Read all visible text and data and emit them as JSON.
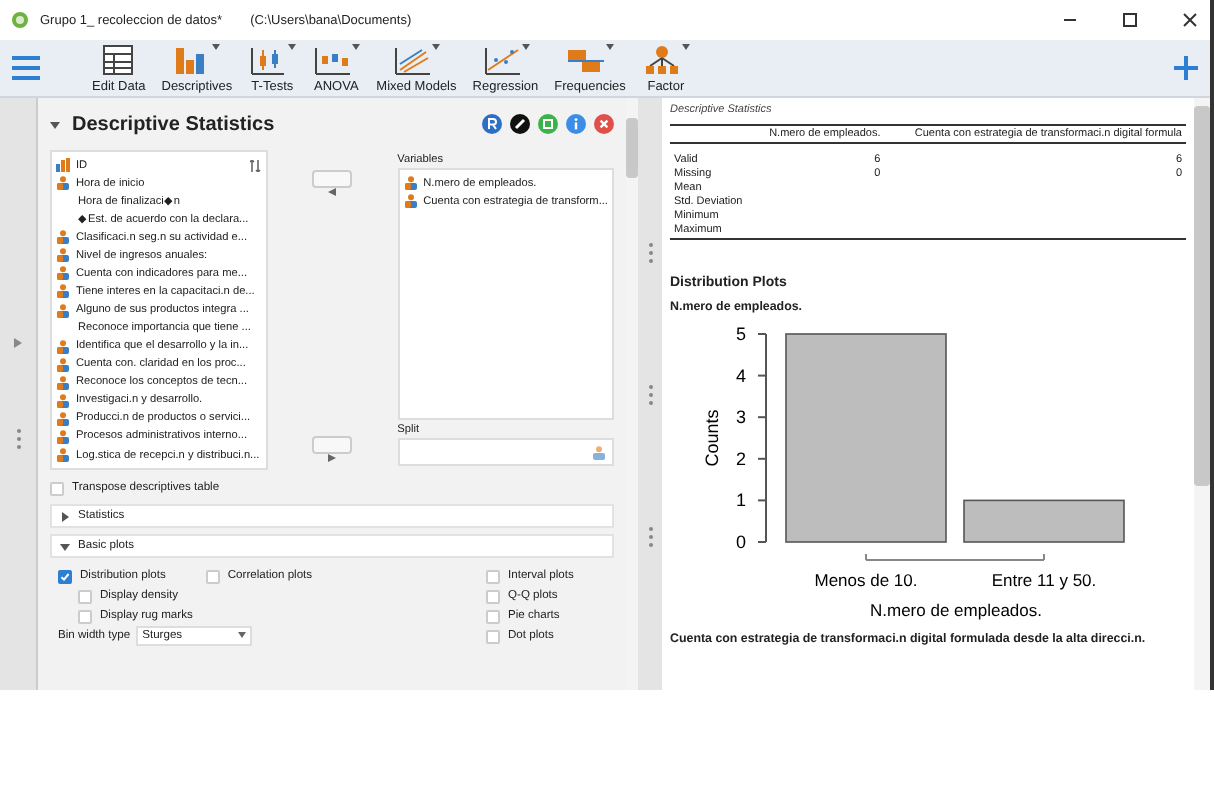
{
  "window": {
    "title": "Grupo 1_ recoleccion de datos*",
    "path": "(C:\\Users\\bana\\Documents)"
  },
  "toolbar": [
    {
      "label": "Edit Data",
      "kind": "table",
      "menu": false
    },
    {
      "label": "Descriptives",
      "kind": "bars",
      "menu": true
    },
    {
      "label": "T-Tests",
      "kind": "ttest",
      "menu": true
    },
    {
      "label": "ANOVA",
      "kind": "anova",
      "menu": true
    },
    {
      "label": "Mixed Models",
      "kind": "mixed",
      "menu": true
    },
    {
      "label": "Regression",
      "kind": "regression",
      "menu": true
    },
    {
      "label": "Frequencies",
      "kind": "frequencies",
      "menu": true
    },
    {
      "label": "Factor",
      "kind": "factor",
      "menu": true
    }
  ],
  "analysis": {
    "title": "Descriptive Statistics",
    "expanded": true,
    "variables_list": [
      {
        "name": "ID",
        "kind": "scale"
      },
      {
        "name": "Hora de inicio",
        "kind": "nominal"
      },
      {
        "name": "Hora de finalizaci◆n",
        "kind": "none"
      },
      {
        "name": "◆Est. de acuerdo con la declara...",
        "kind": "none"
      },
      {
        "name": "Clasificaci.n seg.n su actividad e...",
        "kind": "nominal"
      },
      {
        "name": "Nivel de ingresos anuales:",
        "kind": "nominal"
      },
      {
        "name": "Cuenta con indicadores para me...",
        "kind": "nominal"
      },
      {
        "name": "Tiene interes en la capacitaci.n de...",
        "kind": "nominal"
      },
      {
        "name": "Alguno de sus productos integra ...",
        "kind": "nominal"
      },
      {
        "name": "Reconoce importancia que tiene ...",
        "kind": "none"
      },
      {
        "name": "Identifica que el desarrollo y la in...",
        "kind": "nominal"
      },
      {
        "name": "Cuenta con. claridad en los proc...",
        "kind": "nominal"
      },
      {
        "name": "Reconoce los conceptos de tecn...",
        "kind": "nominal"
      },
      {
        "name": "Investigaci.n y desarrollo.",
        "kind": "nominal"
      },
      {
        "name": "Producci.n de productos o servici...",
        "kind": "nominal"
      },
      {
        "name": "Procesos administrativos interno...",
        "kind": "nominal"
      },
      {
        "name": "Log.stica de recepci.n y distribuci.n...",
        "kind": "nominal"
      }
    ],
    "variables_label": "Variables",
    "assigned": [
      {
        "name": "N.mero de empleados.",
        "kind": "nominal"
      },
      {
        "name": "Cuenta con estrategia de transform...",
        "kind": "nominal"
      }
    ],
    "split_label": "Split",
    "transpose": {
      "label": "Transpose descriptives table",
      "checked": false
    },
    "sections": [
      {
        "title": "Statistics",
        "expanded": false
      },
      {
        "title": "Basic plots",
        "expanded": true
      }
    ],
    "left_options": [
      {
        "label": "Distribution plots",
        "checked": true,
        "children": [
          {
            "label": "Display density",
            "checked": false
          },
          {
            "label": "Display rug marks",
            "checked": false
          }
        ]
      },
      {
        "label": "Correlation plots",
        "checked": false
      }
    ],
    "bin_width": {
      "label": "Bin width type",
      "value": "Sturges"
    },
    "right_options": [
      {
        "label": "Interval plots",
        "checked": false
      },
      {
        "label": "Q-Q plots",
        "checked": false
      },
      {
        "label": "Pie charts",
        "checked": false
      },
      {
        "label": "Dot plots",
        "checked": false
      }
    ]
  },
  "results": {
    "table": {
      "caption": "Descriptive Statistics",
      "columns": [
        "N.mero de empleados.",
        "Cuenta con estrategia de transformaci.n digital formula"
      ],
      "rows": [
        {
          "label": "Valid",
          "values": [
            "6",
            "6"
          ]
        },
        {
          "label": "Missing",
          "values": [
            "0",
            "0"
          ]
        },
        {
          "label": "Mean"
        },
        {
          "label": "Std. Deviation"
        },
        {
          "label": "Minimum"
        },
        {
          "label": "Maximum"
        }
      ]
    },
    "heading": "Distribution Plots",
    "plots": [
      {
        "chart_data": {
          "type": "bar",
          "title": "N.mero de empleados.",
          "xlabel": "N.mero de empleados.",
          "ylabel": "Counts",
          "categories": [
            "Menos de 10.",
            "Entre 11 y 50."
          ],
          "values": [
            5,
            1
          ],
          "ylim": [
            0,
            5
          ],
          "yticks": [
            0,
            1,
            2,
            3,
            4,
            5
          ]
        }
      },
      {
        "title": "Cuenta con estrategia de transformaci.n digital formulada desde la alta direcci.n."
      }
    ]
  }
}
